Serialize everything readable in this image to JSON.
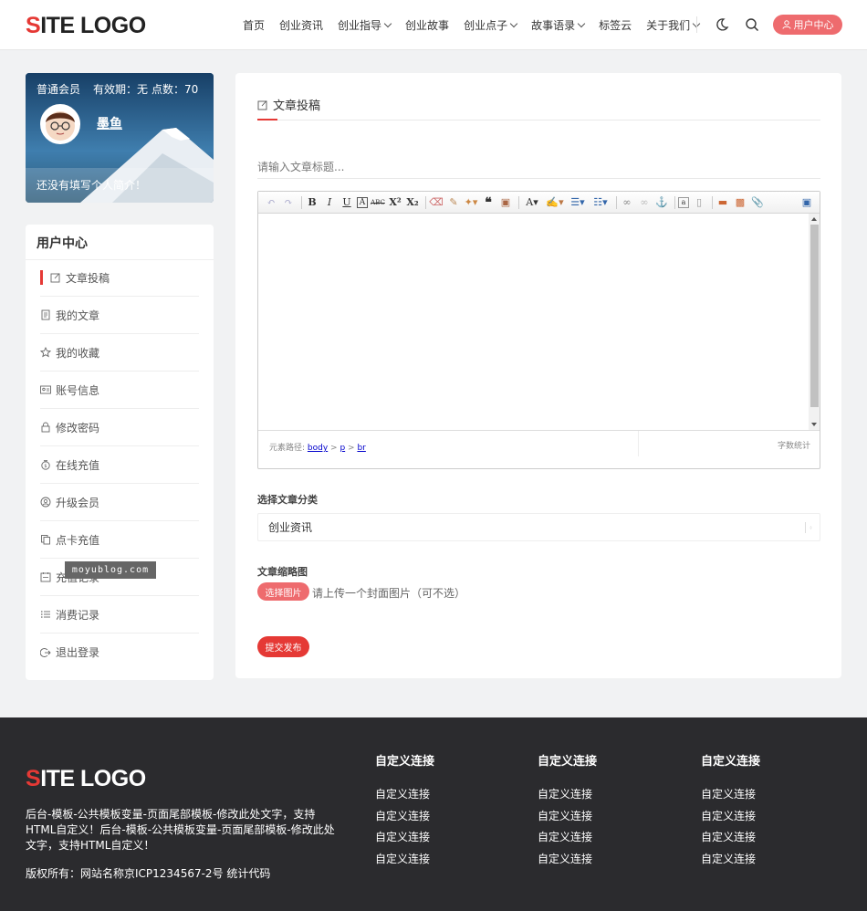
{
  "header": {
    "logo_s": "S",
    "logo_rest": "ITE LOGO",
    "nav": [
      {
        "label": "首页",
        "dropdown": false
      },
      {
        "label": "创业资讯",
        "dropdown": false
      },
      {
        "label": "创业指导",
        "dropdown": true
      },
      {
        "label": "创业故事",
        "dropdown": false
      },
      {
        "label": "创业点子",
        "dropdown": true
      },
      {
        "label": "故事语录",
        "dropdown": true
      },
      {
        "label": "标签云",
        "dropdown": false
      },
      {
        "label": "关于我们",
        "dropdown": true
      }
    ],
    "user_center_label": "用户中心"
  },
  "profile": {
    "member_type": "普通会员",
    "validity": "有效期：无",
    "points": "点数：70",
    "username": "墨鱼",
    "bio": "还没有填写个人简介！"
  },
  "menu": {
    "title": "用户中心",
    "items": [
      {
        "label": "文章投稿",
        "icon": "edit-icon",
        "active": true
      },
      {
        "label": "我的文章",
        "icon": "document-icon",
        "active": false
      },
      {
        "label": "我的收藏",
        "icon": "star-icon",
        "active": false
      },
      {
        "label": "账号信息",
        "icon": "id-card-icon",
        "active": false
      },
      {
        "label": "修改密码",
        "icon": "lock-icon",
        "active": false
      },
      {
        "label": "在线充值",
        "icon": "money-bag-icon",
        "active": false
      },
      {
        "label": "升级会员",
        "icon": "user-circle-icon",
        "active": false
      },
      {
        "label": "点卡充值",
        "icon": "copy-icon",
        "active": false
      },
      {
        "label": "充值记录",
        "icon": "calendar-icon",
        "active": false
      },
      {
        "label": "消费记录",
        "icon": "list-icon",
        "active": false
      },
      {
        "label": "退出登录",
        "icon": "logout-icon",
        "active": false
      }
    ],
    "watermark": "moyublog.com"
  },
  "main": {
    "title": "文章投稿",
    "title_placeholder": "请输入文章标题...",
    "editor": {
      "status_path_label": "元素路径:",
      "path": [
        "body",
        "p",
        "br"
      ],
      "word_count_label": "字数统计"
    },
    "category_label": "选择文章分类",
    "category_value": "创业资讯",
    "thumbnail_label": "文章缩略图",
    "pick_image_label": "选择图片",
    "pick_image_hint": "请上传一个封面图片（可不选）",
    "submit_label": "提交发布"
  },
  "footer": {
    "logo_s": "S",
    "logo_rest": "ITE LOGO",
    "description": "后台-模板-公共模板变量-页面尾部模板-修改此处文字，支持HTML自定义！后台-模板-公共模板变量-页面尾部模板-修改此处文字，支持HTML自定义！",
    "copyright": "版权所有：网站名称京ICP1234567-2号 统计代码",
    "columns": [
      {
        "title": "自定义连接",
        "links": [
          "自定义连接",
          "自定义连接",
          "自定义连接",
          "自定义连接"
        ]
      },
      {
        "title": "自定义连接",
        "links": [
          "自定义连接",
          "自定义连接",
          "自定义连接",
          "自定义连接"
        ]
      },
      {
        "title": "自定义连接",
        "links": [
          "自定义连接",
          "自定义连接",
          "自定义连接",
          "自定义连接"
        ]
      }
    ]
  },
  "colors": {
    "accent": "#e53935",
    "button_pink": "#ee6b6e",
    "footer_bg": "#2b2b2e"
  }
}
